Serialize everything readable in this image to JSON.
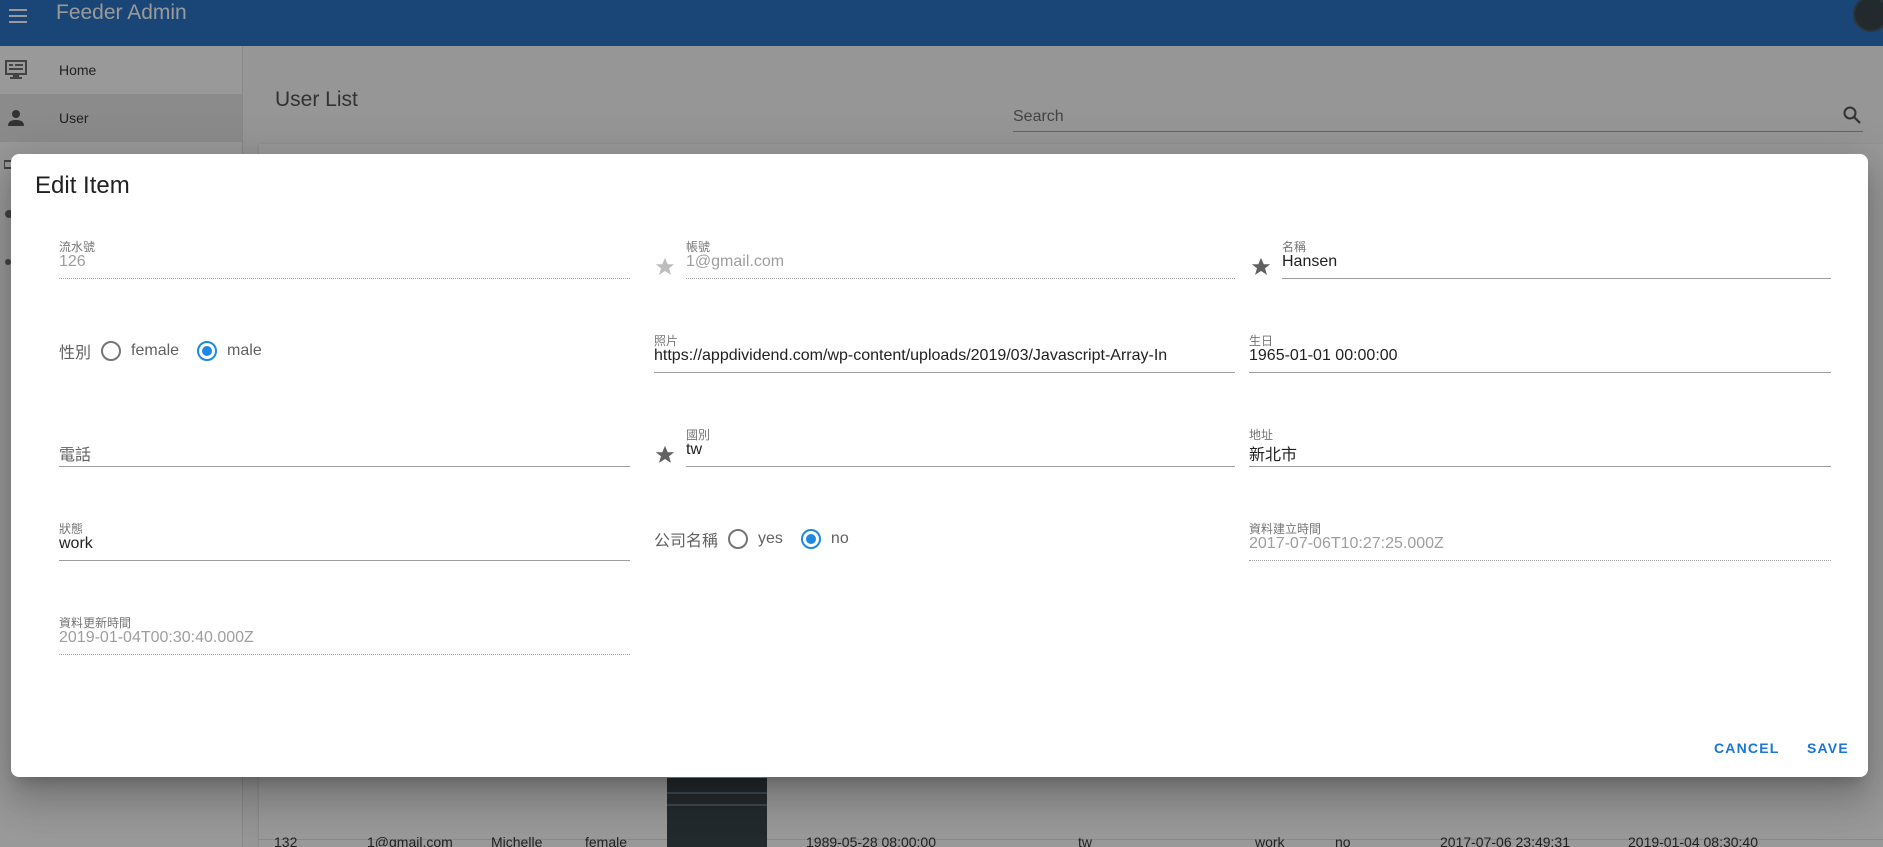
{
  "app": {
    "title": "Feeder Admin"
  },
  "sidebar": {
    "items": [
      {
        "label": "Home",
        "icon": "desktop-icon"
      },
      {
        "label": "User",
        "icon": "person-icon"
      }
    ]
  },
  "main": {
    "title": "User List",
    "search": {
      "placeholder": "Search"
    },
    "background_row": {
      "cells": [
        "132",
        "1@gmail.com",
        "Michelle",
        "female",
        "1989-05-28 08:00:00",
        "tw",
        "work",
        "no",
        "2017-07-06 23:49:31",
        "2019-01-04 08:30:40"
      ]
    }
  },
  "dialog": {
    "title": "Edit Item",
    "fields": {
      "serial": {
        "label": "流水號",
        "value": "126"
      },
      "account": {
        "label": "帳號",
        "value": "1@gmail.com"
      },
      "name": {
        "label": "名稱",
        "value": "Hansen"
      },
      "gender": {
        "label": "性別",
        "options": [
          "female",
          "male"
        ],
        "selected": "male"
      },
      "photo": {
        "label": "照片",
        "value": "https://appdividend.com/wp-content/uploads/2019/03/Javascript-Array-In"
      },
      "birthday": {
        "label": "生日",
        "value": "1965-01-01 00:00:00"
      },
      "phone": {
        "placeholder": "電話"
      },
      "country": {
        "label": "國別",
        "value": "tw"
      },
      "address": {
        "label": "地址",
        "value": "新北市"
      },
      "status": {
        "label": "狀態",
        "value": "work"
      },
      "company": {
        "label": "公司名稱",
        "options": [
          "yes",
          "no"
        ],
        "selected": "no"
      },
      "created_at": {
        "label": "資料建立時間",
        "value": "2017-07-06T10:27:25.000Z"
      },
      "updated_at": {
        "label": "資料更新時間",
        "value": "2019-01-04T00:30:40.000Z"
      }
    },
    "actions": {
      "cancel": "CANCEL",
      "save": "SAVE"
    }
  },
  "colors": {
    "appbar": "#1565c0",
    "accent": "#1e88e5",
    "button": "#1976d2"
  }
}
